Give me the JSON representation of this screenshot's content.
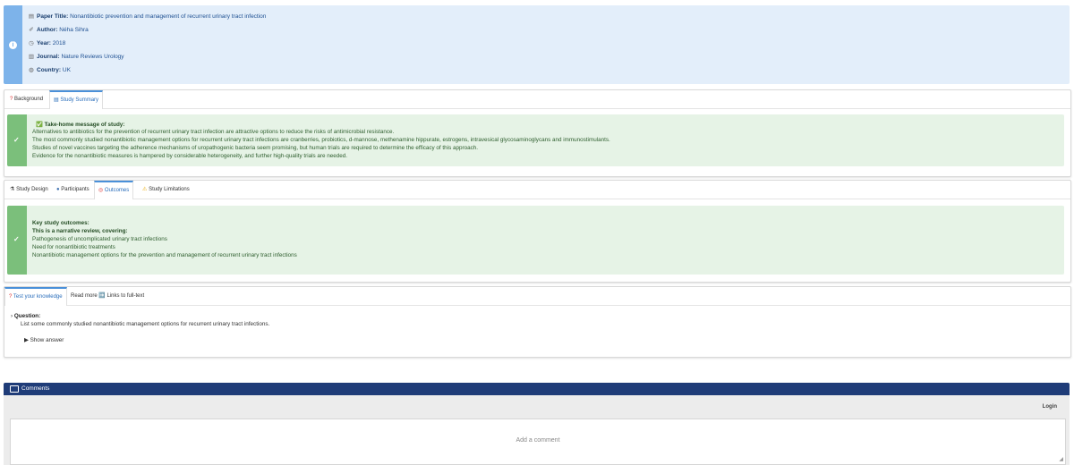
{
  "paper": {
    "title_label": "Paper Title:",
    "title": "Nonantibiotic prevention and management of recurrent urinary tract infection",
    "author_label": "Author:",
    "author": "Néha Sihra",
    "year_label": "Year:",
    "year": "2018",
    "journal_label": "Journal:",
    "journal": "Nature Reviews Urology",
    "country_label": "Country:",
    "country": "UK"
  },
  "summary_panel": {
    "tabs": [
      {
        "label": "Background",
        "icon": "question-icon"
      },
      {
        "label": "Study Summary",
        "icon": "notepad-icon"
      }
    ],
    "heading": "✅ Take-home message of study:",
    "lines": [
      "Alternatives to antibiotics for the prevention of recurrent urinary tract infection are attractive options to reduce the risks of antimicrobial resistance.",
      "The most commonly studied nonantibiotic management options for recurrent urinary tract infections are cranberries, probiotics, d-mannose, methenamine hippurate, estrogens, intravesical glycosaminoglycans and immunostimulants.",
      "Studies of novel vaccines targeting the adherence mechanisms of uropathogenic bacteria seem promising, but human trials are required to determine the efficacy of this approach.",
      "Evidence for the nonantibiotic measures is hampered by considerable heterogeneity, and further high-quality trials are needed."
    ]
  },
  "outcomes_panel": {
    "tabs": [
      {
        "label": "Study Design"
      },
      {
        "label": "Participants"
      },
      {
        "label": "Outcomes"
      },
      {
        "label": "Study Limitations"
      }
    ],
    "heading": "Key study outcomes:",
    "subheading": "This is a narrative review, covering:",
    "lines": [
      "Pathogenesis of uncomplicated urinary tract infections",
      "Need for nonantibiotic treatments",
      "Nonantibiotic management options for the prevention and management of recurrent urinary tract infections"
    ]
  },
  "knowledge_panel": {
    "tabs": [
      {
        "label": "Test your knowledge"
      },
      {
        "label": "Read more ➡️ Links to full-text"
      }
    ],
    "question_label": "Question:",
    "question": "List some commonly studied nonantibiotic management options for recurrent urinary tract infections.",
    "show_answer": "Show answer"
  },
  "comments": {
    "title": "Comments",
    "login": "Login",
    "placeholder": "Add a comment"
  },
  "colors": {
    "info_bar": "#7db3ea",
    "success_bar": "#7bbf7b",
    "comments_header": "#1f3c78"
  }
}
